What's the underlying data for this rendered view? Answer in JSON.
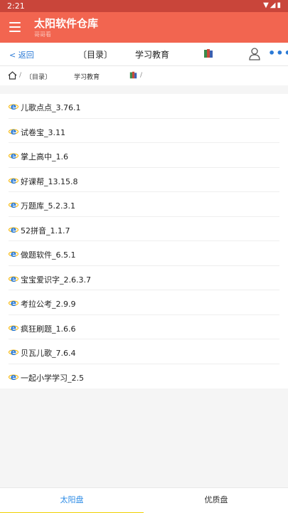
{
  "status_bar": {
    "time": "2:21",
    "icons": "▼◢▮"
  },
  "app_bar": {
    "title": "太阳软件仓库",
    "subtitle": "哥哥看"
  },
  "nav_bar": {
    "back_label": "返回",
    "dir_label": "〔目录〕",
    "category_label": "学习教育",
    "more_label": "•••"
  },
  "breadcrumb": {
    "separator": "/",
    "dir_label": "〔目录〕",
    "category_label": "学习教育"
  },
  "items": [
    {
      "label": "儿歌点点_3.76.1"
    },
    {
      "label": "试卷宝_3.11"
    },
    {
      "label": "掌上高中_1.6"
    },
    {
      "label": "好课帮_13.15.8"
    },
    {
      "label": "万题库_5.2.3.1"
    },
    {
      "label": "52拼音_1.1.7"
    },
    {
      "label": "做题软件_6.5.1"
    },
    {
      "label": "宝宝爱识字_2.6.3.7"
    },
    {
      "label": "考拉公考_2.9.9"
    },
    {
      "label": "疯狂刷题_1.6.6"
    },
    {
      "label": "贝瓦儿歌_7.6.4"
    },
    {
      "label": "一起小学学习_2.5"
    }
  ],
  "bottom_tabs": {
    "tab1": "太阳盘",
    "tab2": "优质盘"
  },
  "colors": {
    "app_bar": "#f26550",
    "status_bar": "#c9453a",
    "accent": "#2b7ad6",
    "tab_indicator": "#f0d000"
  }
}
